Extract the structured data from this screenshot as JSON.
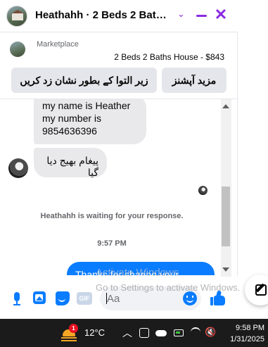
{
  "header": {
    "title": "Heathahh · 2 Beds 2 Baths ...",
    "chevron_glyph": "⌄",
    "close_glyph": "✕"
  },
  "listing": {
    "marketplace_label": "Marketplace",
    "subtitle": "2 Beds 2 Baths House - $843"
  },
  "chips": {
    "more_options": "مزید آپشنز",
    "mark_pending": "زیر التوا کے بطور نشان زد کریں"
  },
  "messages": [
    {
      "direction": "incoming",
      "lines": [
        "my name is Heather",
        "my number is",
        "9854636396"
      ]
    },
    {
      "direction": "incoming",
      "text": "پیغام بھیج دیا گیا"
    },
    {
      "direction": "outgoing",
      "text": "Thanks for sharing your"
    }
  ],
  "status": {
    "waiting": "Heathahh is waiting for your response.",
    "time": "9:57 PM"
  },
  "composer": {
    "placeholder": "Aa",
    "gif_label": "GIF",
    "icons": [
      "microphone-icon",
      "image-icon",
      "sticker-icon",
      "gif-icon",
      "emoji-icon",
      "like-icon"
    ]
  },
  "watermark": {
    "line1": "Activate Windows",
    "line2": "Go to Settings to activate Windows."
  },
  "taskbar": {
    "weather_badge": "1",
    "temperature": "12°C",
    "tray_chevron": "︿",
    "volume_glyph": "🔇",
    "time": "9:58 PM",
    "date": "1/31/2025"
  },
  "colors": {
    "accent": "#8a2be2",
    "messenger_blue": "#0a7cff",
    "incoming_bubble": "#e9e9eb",
    "taskbar": "#1b1b1b"
  }
}
